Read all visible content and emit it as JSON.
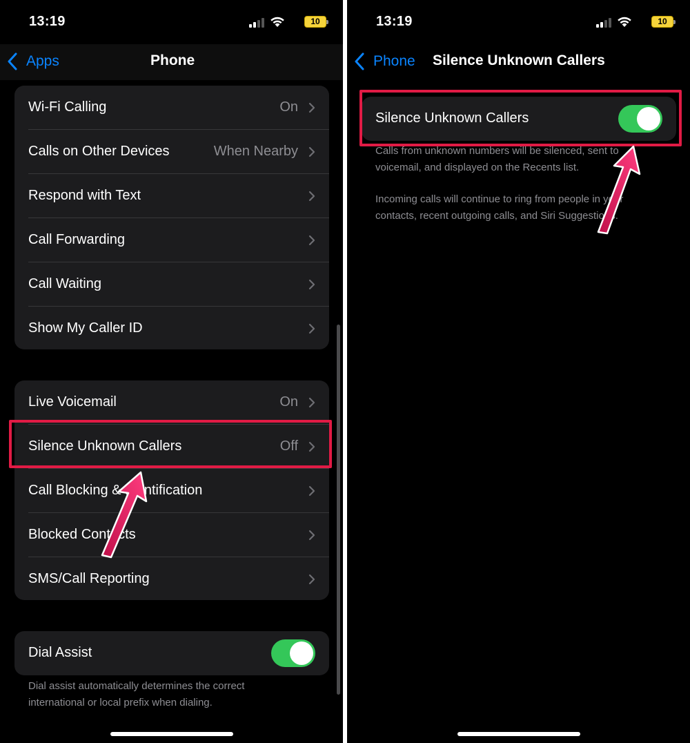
{
  "left_screen": {
    "status": {
      "time": "13:19",
      "battery": "10"
    },
    "nav": {
      "back_label": "Apps",
      "title": "Phone"
    },
    "calling_group": [
      {
        "label": "Wi-Fi Calling",
        "value": "On"
      },
      {
        "label": "Calls on Other Devices",
        "value": "When Nearby"
      },
      {
        "label": "Respond with Text",
        "value": ""
      },
      {
        "label": "Call Forwarding",
        "value": ""
      },
      {
        "label": "Call Waiting",
        "value": ""
      },
      {
        "label": "Show My Caller ID",
        "value": ""
      }
    ],
    "voicemail_group": [
      {
        "label": "Live Voicemail",
        "value": "On"
      },
      {
        "label": "Silence Unknown Callers",
        "value": "Off"
      },
      {
        "label": "Call Blocking & Identification",
        "value": ""
      },
      {
        "label": "Blocked Contacts",
        "value": ""
      },
      {
        "label": "SMS/Call Reporting",
        "value": ""
      }
    ],
    "dial_assist": {
      "label": "Dial Assist",
      "enabled": true,
      "footnote_line1": "Dial assist automatically determines the correct",
      "footnote_line2": "international or local prefix when dialing."
    }
  },
  "right_screen": {
    "status": {
      "time": "13:19",
      "battery": "10"
    },
    "nav": {
      "back_label": "Phone",
      "title": "Silence Unknown Callers"
    },
    "toggle_row": {
      "label": "Silence Unknown Callers",
      "enabled": true
    },
    "footnote_1_line1": "Calls from unknown numbers will be silenced, sent to",
    "footnote_1_line2": "voicemail, and displayed on the Recents list.",
    "footnote_2_line1": "Incoming calls will continue to ring from people in your",
    "footnote_2_line2": "contacts, recent outgoing calls, and Siri Suggestions."
  },
  "colors": {
    "accent_blue": "#0a84ff",
    "toggle_green": "#34c759",
    "highlight_red": "#e11b45",
    "arrow_pink": "#f0286a"
  }
}
